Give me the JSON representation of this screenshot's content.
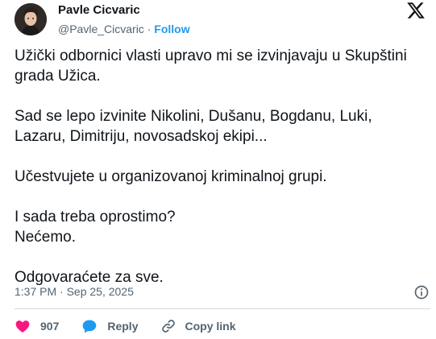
{
  "tweet": {
    "display_name": "Pavle Cicvaric",
    "handle": "@Pavle_Cicvaric",
    "separator": " · ",
    "follow_label": "Follow",
    "text": "Užički odbornici vlasti upravo mi se izvinjavaju u Skupštini\ngrada Užica.\n\nSad se lepo izvinite Nikolini, Dušanu, Bogdanu, Luki,\nLazaru, Dimitriju, novosadskoj ekipi...\n\nUčestvujete u organizovanoj kriminalnoj grupi.\n\nI sada treba oprostimo?\nNećemo.\n\nOdgovaraćete za sve.",
    "timestamp": "1:37 PM · Sep 25, 2025"
  },
  "actions": {
    "like_count": "907",
    "reply_label": "Reply",
    "copy_link_label": "Copy link"
  },
  "icons": {
    "x_logo": "x-logo-icon",
    "info": "info-icon",
    "like": "heart-icon",
    "reply": "speech-bubble-icon",
    "copy": "link-icon"
  },
  "colors": {
    "text": "#0f1419",
    "secondary": "#536471",
    "accent": "#1d9bf0",
    "like": "#f91880",
    "divider": "#cfd9de"
  }
}
